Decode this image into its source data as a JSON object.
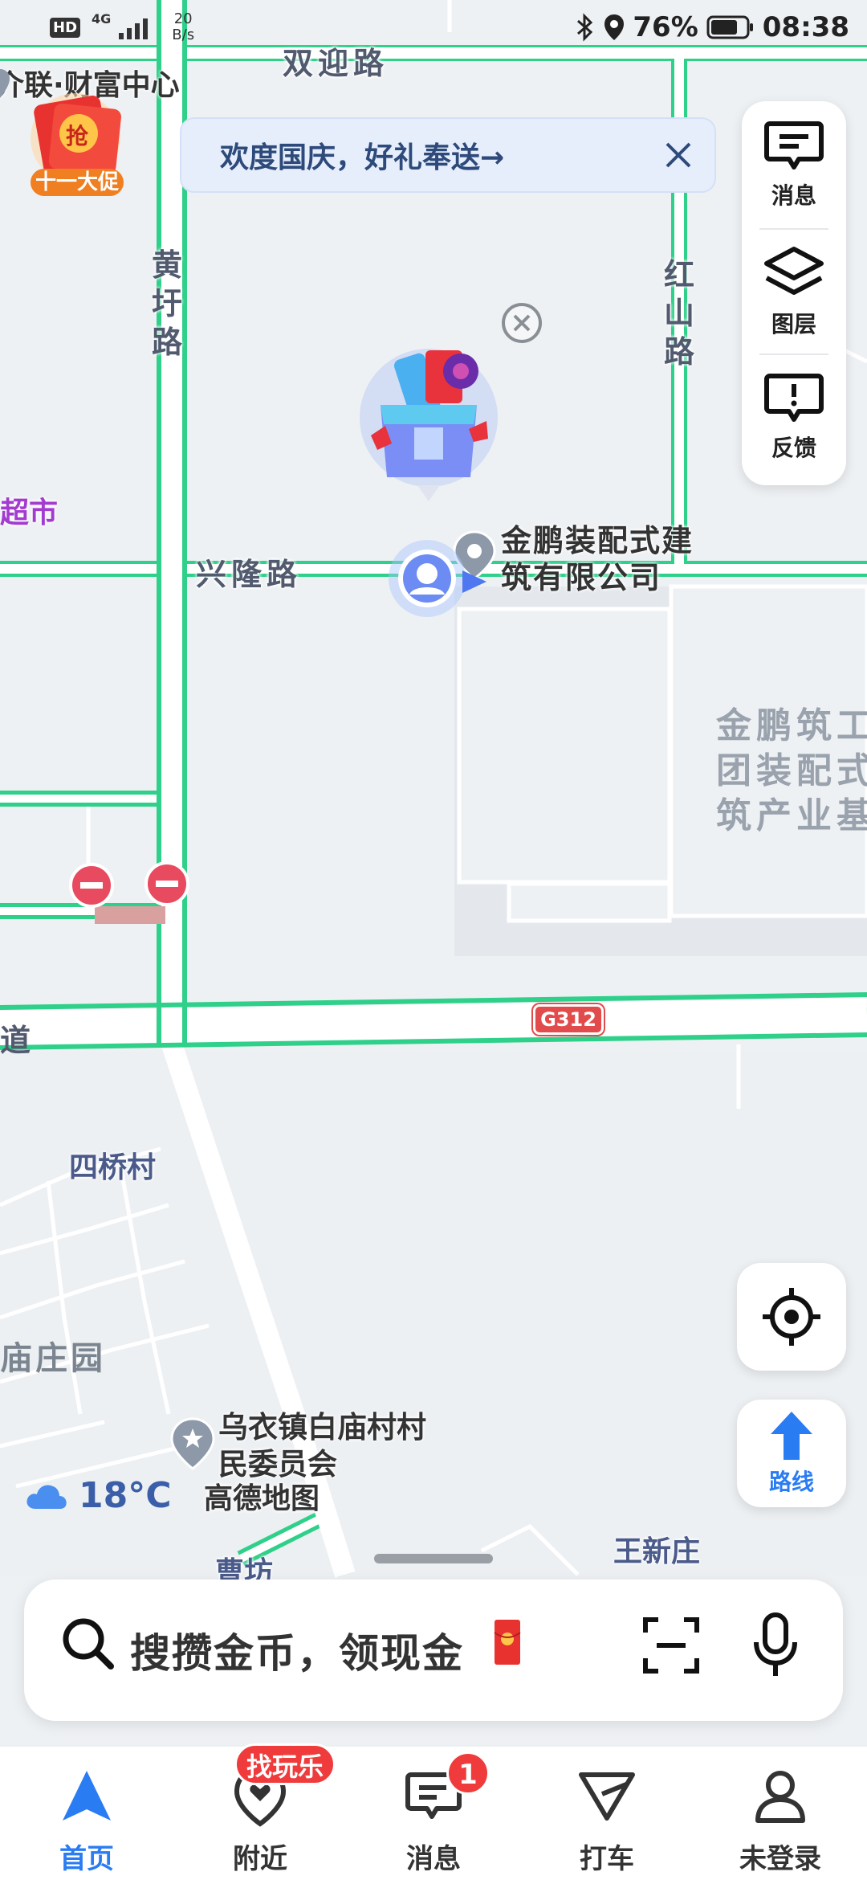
{
  "status_bar": {
    "hd": "HD",
    "network": "4G",
    "speed_value": "20",
    "speed_unit": "B/s",
    "battery": "76%",
    "time": "08:38"
  },
  "map": {
    "roads": {
      "top": "双迎路",
      "left_vertical": "黄圩路",
      "right_vertical": "红山路",
      "middle": "兴隆路",
      "highway_shield": "G312",
      "left_edge_fragment": "道"
    },
    "places": {
      "top_left_poi": "介联·财富中心",
      "supermarket": "超市",
      "company": "金鹏装配式建筑有限公司",
      "industrial_area": "金鹏筑工团装配式筑产业基",
      "village_siqiao": "四桥村",
      "miaozhuang": "庙庄园",
      "committee": "乌衣镇白庙村村民委员会",
      "wangxinzhuang": "王新庄",
      "caofang": "曹坊"
    },
    "logo": "高德地图"
  },
  "promo": {
    "badge_top": "抢",
    "badge_bottom": "十一大促",
    "banner_text": "欢度国庆，好礼奉送→"
  },
  "right_panel": {
    "messages": "消息",
    "layers": "图层",
    "feedback": "反馈"
  },
  "weather": {
    "temp": "18°C"
  },
  "route_button": {
    "label": "路线"
  },
  "search": {
    "placeholder": "搜攒金币，领现金"
  },
  "bottom_nav": {
    "items": [
      {
        "label": "首页"
      },
      {
        "label": "附近",
        "badge": "找玩乐"
      },
      {
        "label": "消息",
        "badge": "1"
      },
      {
        "label": "打车"
      },
      {
        "label": "未登录"
      }
    ]
  },
  "colors": {
    "road_edge": "#2fd08a",
    "road_fill": "#ffffff",
    "accent": "#2a7cf3",
    "badge_red": "#ef3b3b",
    "map_bg": "#eef1f4"
  }
}
